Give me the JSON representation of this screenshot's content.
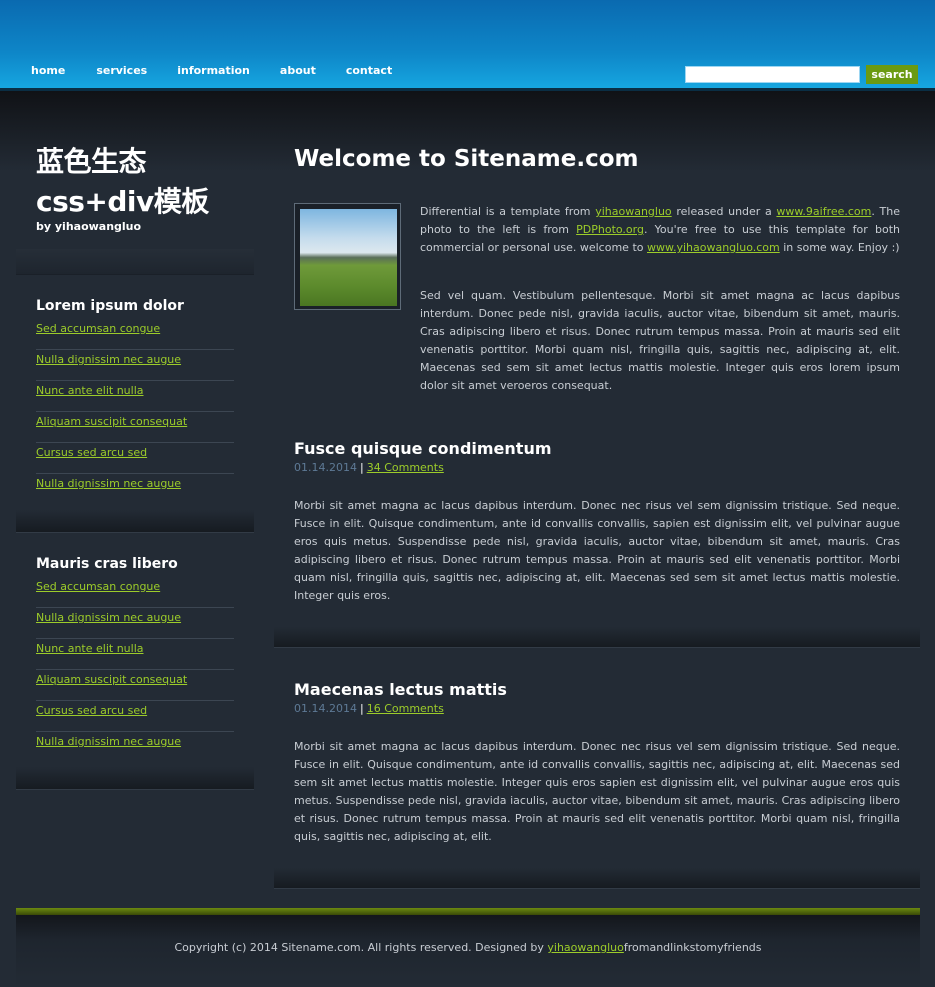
{
  "nav": [
    "home",
    "services",
    "information",
    "about",
    "contact"
  ],
  "search": {
    "button": "search",
    "value": ""
  },
  "site": {
    "title_line1": "蓝色生态",
    "title_line2": "css+div模板",
    "subtitle": "by yihaowangluo"
  },
  "sidebar": [
    {
      "heading": "Lorem ipsum dolor",
      "links": [
        "Sed accumsan congue",
        "Nulla dignissim nec augue",
        "Nunc ante elit nulla",
        "Aliquam suscipit consequat",
        "Cursus sed arcu sed",
        "Nulla dignissim nec augue"
      ]
    },
    {
      "heading": "Mauris cras libero",
      "links": [
        "Sed accumsan congue",
        "Nulla dignissim nec augue",
        "Nunc ante elit nulla",
        "Aliquam suscipit consequat",
        "Cursus sed arcu sed",
        "Nulla dignissim nec augue"
      ]
    }
  ],
  "welcome": {
    "title": "Welcome to Sitename.com",
    "p1": {
      "t1": "Differential is a template from ",
      "l1": "yihaowangluo",
      "t2": " released under a ",
      "l2": "www.9aifree.com",
      "t3": ". The photo to the left is from ",
      "l3": "PDPhoto.org",
      "t4": ". You're free to use this template for both commercial or personal use. welcome to ",
      "l4": "www.yihaowangluo.com",
      "t5": " in some way. Enjoy :)"
    },
    "p2": "Sed vel quam. Vestibulum pellentesque. Morbi sit amet magna ac lacus dapibus interdum. Donec pede nisl, gravida iaculis, auctor vitae, bibendum sit amet, mauris. Cras adipiscing libero et risus. Donec rutrum tempus massa. Proin at mauris sed elit venenatis porttitor. Morbi quam nisl, fringilla quis, sagittis nec, adipiscing at, elit. Maecenas sed sem sit amet lectus mattis molestie. Integer quis eros lorem ipsum dolor sit amet veroeros consequat."
  },
  "posts": [
    {
      "title": "Fusce quisque condimentum",
      "date": "01.14.2014",
      "sep": "|",
      "comments": "34 Comments",
      "body": "Morbi sit amet magna ac lacus dapibus interdum. Donec nec risus vel sem dignissim tristique. Sed neque. Fusce in elit. Quisque condimentum, ante id convallis convallis, sapien est dignissim elit, vel pulvinar augue eros quis metus. Suspendisse pede nisl, gravida iaculis, auctor vitae, bibendum sit amet, mauris. Cras adipiscing libero et risus. Donec rutrum tempus massa. Proin at mauris sed elit venenatis porttitor. Morbi quam nisl, fringilla quis, sagittis nec, adipiscing at, elit. Maecenas sed sem sit amet lectus mattis molestie. Integer quis eros."
    },
    {
      "title": "Maecenas lectus mattis",
      "date": "01.14.2014",
      "sep": "|",
      "comments": "16 Comments",
      "body": "Morbi sit amet magna ac lacus dapibus interdum. Donec nec risus vel sem dignissim tristique. Sed neque. Fusce in elit. Quisque condimentum, ante id convallis convallis, sagittis nec, adipiscing at, elit. Maecenas sed sem sit amet lectus mattis molestie. Integer quis eros sapien est dignissim elit, vel pulvinar augue eros quis metus. Suspendisse pede nisl, gravida iaculis, auctor vitae, bibendum sit amet, mauris. Cras adipiscing libero et risus. Donec rutrum tempus massa. Proin at mauris sed elit venenatis porttitor. Morbi quam nisl, fringilla quis, sagittis nec, adipiscing at, elit."
    }
  ],
  "footer": {
    "text": "Copyright (c) 2014 Sitename.com. All rights reserved. Designed by ",
    "link": "yihaowangluo",
    "suffix": "fromandlinkstomyfriends"
  },
  "colors": {
    "header_blue": "#0e86c8",
    "link_green": "#9ccc2a",
    "search_button": "#6b9a12",
    "background": "#232b35"
  }
}
